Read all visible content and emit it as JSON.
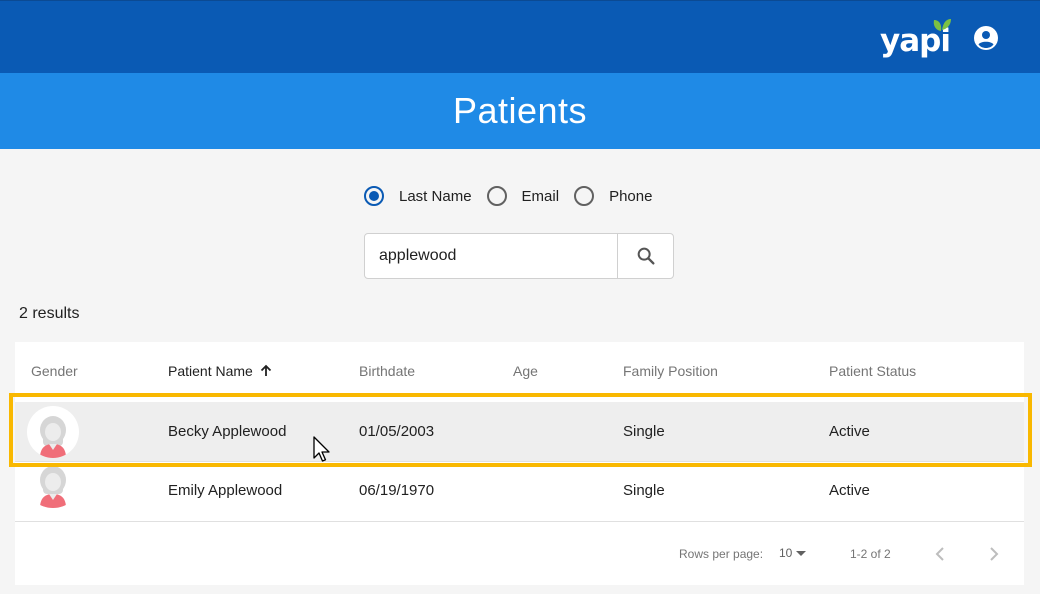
{
  "header": {
    "logo_text": "yapi",
    "brand_color": "#0a5ab4",
    "leaf_color": "#7bc143",
    "account_icon": "account-circle-icon"
  },
  "page": {
    "title": "Patients"
  },
  "search": {
    "options": [
      {
        "label": "Last Name",
        "checked": true
      },
      {
        "label": "Email",
        "checked": false
      },
      {
        "label": "Phone",
        "checked": false
      }
    ],
    "value": "applewood",
    "button_icon": "search-icon"
  },
  "results": {
    "count_text": "2 results"
  },
  "table": {
    "columns": {
      "gender": "Gender",
      "name": "Patient Name",
      "birthdate": "Birthdate",
      "age": "Age",
      "family_position": "Family Position",
      "status": "Patient Status"
    },
    "sort_icon": "arrow-up-icon",
    "rows": [
      {
        "gender_icon": "female-avatar-icon",
        "name": "Becky Applewood",
        "birthdate": "01/05/2003",
        "age": "",
        "family_position": "Single",
        "status": "Active"
      },
      {
        "gender_icon": "female-avatar-icon",
        "name": "Emily Applewood",
        "birthdate": "06/19/1970",
        "age": "",
        "family_position": "Single",
        "status": "Active"
      }
    ],
    "highlight_color": "#f9b800"
  },
  "pagination": {
    "rows_per_page_label": "Rows per page:",
    "rows_per_page_value": "10",
    "range_text": "1-2 of 2",
    "prev_icon": "chevron-left-icon",
    "next_icon": "chevron-right-icon"
  }
}
